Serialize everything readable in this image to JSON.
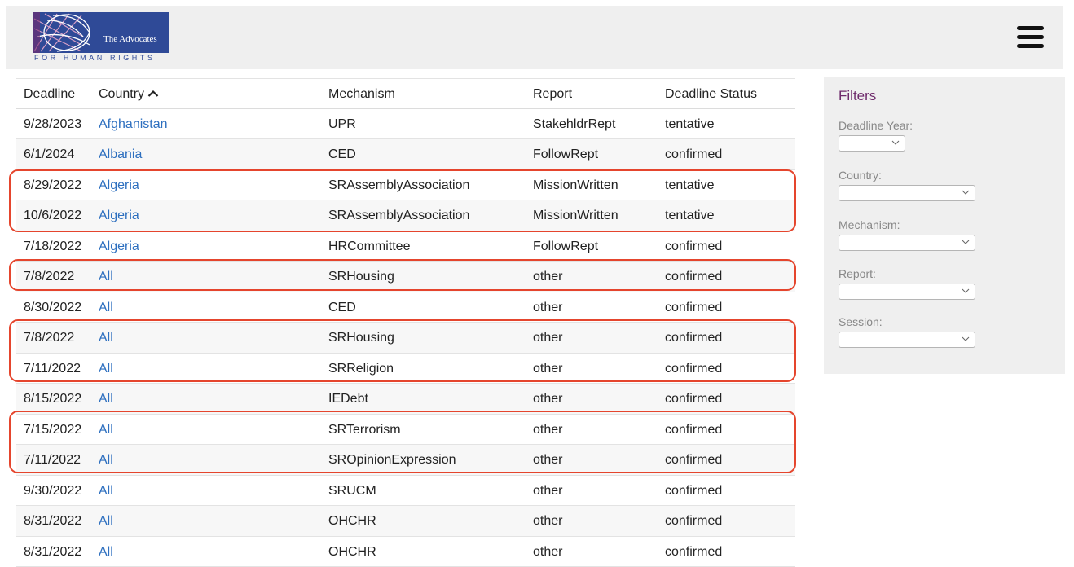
{
  "header": {
    "logo_name": "The Advocates",
    "logo_sub": "FOR HUMAN RIGHTS"
  },
  "table": {
    "columns": [
      "Deadline",
      "Country",
      "Mechanism",
      "Report",
      "Deadline Status"
    ],
    "rows": [
      {
        "deadline": "9/28/2023",
        "country": "Afghanistan",
        "mechanism": "UPR",
        "report": "StakehldrRept",
        "status": "tentative"
      },
      {
        "deadline": "6/1/2024",
        "country": "Albania",
        "mechanism": "CED",
        "report": "FollowRept",
        "status": "confirmed"
      },
      {
        "deadline": "8/29/2022",
        "country": "Algeria",
        "mechanism": "SRAssemblyAssociation",
        "report": "MissionWritten",
        "status": "tentative"
      },
      {
        "deadline": "10/6/2022",
        "country": "Algeria",
        "mechanism": "SRAssemblyAssociation",
        "report": "MissionWritten",
        "status": "tentative"
      },
      {
        "deadline": "7/18/2022",
        "country": "Algeria",
        "mechanism": "HRCommittee",
        "report": "FollowRept",
        "status": "confirmed"
      },
      {
        "deadline": "7/8/2022",
        "country": "All",
        "mechanism": "SRHousing",
        "report": "other",
        "status": "confirmed"
      },
      {
        "deadline": "8/30/2022",
        "country": "All",
        "mechanism": "CED",
        "report": "other",
        "status": "confirmed"
      },
      {
        "deadline": "7/8/2022",
        "country": "All",
        "mechanism": "SRHousing",
        "report": "other",
        "status": "confirmed"
      },
      {
        "deadline": "7/11/2022",
        "country": "All",
        "mechanism": "SRReligion",
        "report": "other",
        "status": "confirmed"
      },
      {
        "deadline": "8/15/2022",
        "country": "All",
        "mechanism": "IEDebt",
        "report": "other",
        "status": "confirmed"
      },
      {
        "deadline": "7/15/2022",
        "country": "All",
        "mechanism": "SRTerrorism",
        "report": "other",
        "status": "confirmed"
      },
      {
        "deadline": "7/11/2022",
        "country": "All",
        "mechanism": "SROpinionExpression",
        "report": "other",
        "status": "confirmed"
      },
      {
        "deadline": "9/30/2022",
        "country": "All",
        "mechanism": "SRUCM",
        "report": "other",
        "status": "confirmed"
      },
      {
        "deadline": "8/31/2022",
        "country": "All",
        "mechanism": "OHCHR",
        "report": "other",
        "status": "confirmed"
      },
      {
        "deadline": "8/31/2022",
        "country": "All",
        "mechanism": "OHCHR",
        "report": "other",
        "status": "confirmed"
      }
    ]
  },
  "filters": {
    "title": "Filters",
    "deadline_year_label": "Deadline Year:",
    "country_label": "Country:",
    "mechanism_label": "Mechanism:",
    "report_label": "Report:",
    "session_label": "Session:"
  },
  "colors": {
    "link": "#2d6fbf",
    "highlight": "#e5452d",
    "filters_title": "#6e2a6b",
    "logo_bg": "#2f4a97"
  }
}
